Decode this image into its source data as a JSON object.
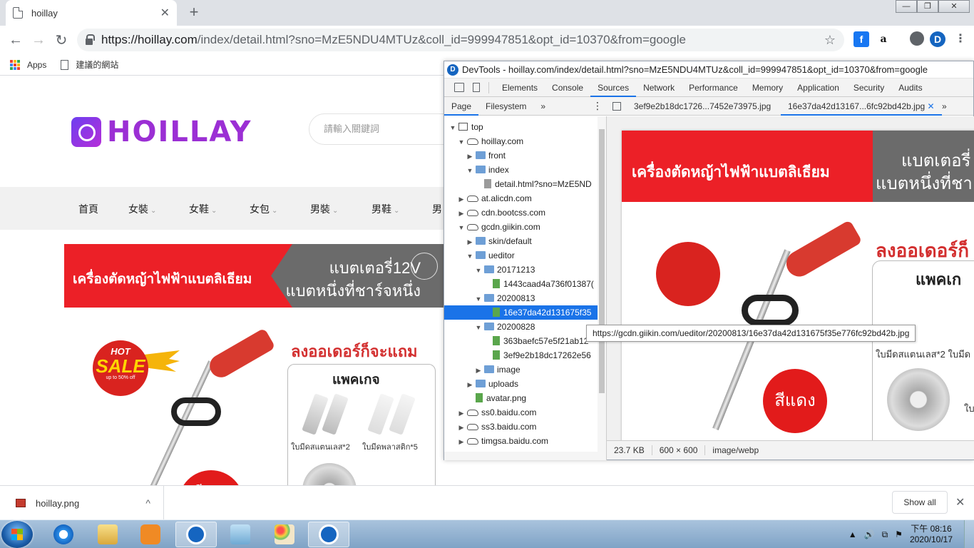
{
  "browser": {
    "tab_title": "hoillay",
    "tab_close": "✕",
    "new_tab": "+",
    "window_buttons": [
      "—",
      "❐",
      "✕"
    ],
    "url_host": "https://hoillay.com",
    "url_path": "/index/detail.html?sno=MzE5NDU4MTUz&coll_id=999947851&opt_id=10370&from=google",
    "nav": {
      "back": "←",
      "forward": "→",
      "reload": "↻"
    },
    "star": "☆",
    "extensions": {
      "facebook": "f",
      "amazon": "a",
      "downloader": "D",
      "menu": "⋮"
    },
    "bookmarks": [
      {
        "label": "Apps",
        "icon": "apps-grid-icon"
      },
      {
        "label": "建議的網站",
        "icon": "page-icon"
      }
    ]
  },
  "page": {
    "logo_text": "HOILLAY",
    "search_placeholder": "請輸入關鍵詞",
    "categories": [
      {
        "label": "首頁",
        "has_menu": false
      },
      {
        "label": "女裝",
        "has_menu": true
      },
      {
        "label": "女鞋",
        "has_menu": true
      },
      {
        "label": "女包",
        "has_menu": true
      },
      {
        "label": "男裝",
        "has_menu": true
      },
      {
        "label": "男鞋",
        "has_menu": true
      },
      {
        "label": "男",
        "has_menu": false
      }
    ],
    "category_chevron": "⌄",
    "banner": {
      "title": "เครื่องตัดหญ้าไฟฟ้าแบตลิเธียม",
      "sub1": "แบตเตอรี่12V",
      "sub2": "แบตหนึ่งที่ชาร์จหนึ่ง"
    },
    "product": {
      "sale_hot": "HOT",
      "sale_big": "SALE",
      "sale_small": "up to 50% off",
      "order_title": "ลงออเดอร์ก็จะแถม",
      "package_title": "แพคเกจ",
      "caption1": "ใบมีดสแตนเลส*2",
      "caption2": "ใบมีดพลาสติก*5",
      "color_label": "สีแดง"
    }
  },
  "devtools": {
    "title": "DevTools - hoillay.com/index/detail.html?sno=MzE5NDU4MTUz&coll_id=999947851&opt_id=10370&from=google",
    "logo": "D",
    "tabs": [
      "Elements",
      "Console",
      "Sources",
      "Network",
      "Performance",
      "Memory",
      "Application",
      "Security",
      "Audits"
    ],
    "active_tab": "Sources",
    "nav_tabs": [
      "Page",
      "Filesystem"
    ],
    "more": "»",
    "kebab": "⋮",
    "open_files": [
      {
        "name": "3ef9e2b18dc1726...7452e73975.jpg",
        "active": false
      },
      {
        "name": "16e37da42d13167...6fc92bd42b.jpg",
        "active": true
      }
    ],
    "close_tab": "✕",
    "tree": [
      {
        "depth": 0,
        "arrow": "▼",
        "icon": "frame",
        "label": "top"
      },
      {
        "depth": 1,
        "arrow": "▼",
        "icon": "cloud",
        "label": "hoillay.com"
      },
      {
        "depth": 2,
        "arrow": "▶",
        "icon": "folder",
        "label": "front"
      },
      {
        "depth": 2,
        "arrow": "▼",
        "icon": "folder",
        "label": "index"
      },
      {
        "depth": 3,
        "arrow": "",
        "icon": "file",
        "label": "detail.html?sno=MzE5ND"
      },
      {
        "depth": 1,
        "arrow": "▶",
        "icon": "cloud",
        "label": "at.alicdn.com"
      },
      {
        "depth": 1,
        "arrow": "▶",
        "icon": "cloud",
        "label": "cdn.bootcss.com"
      },
      {
        "depth": 1,
        "arrow": "▼",
        "icon": "cloud",
        "label": "gcdn.giikin.com"
      },
      {
        "depth": 2,
        "arrow": "▶",
        "icon": "folder",
        "label": "skin/default"
      },
      {
        "depth": 2,
        "arrow": "▼",
        "icon": "folder",
        "label": "ueditor"
      },
      {
        "depth": 3,
        "arrow": "▼",
        "icon": "folder",
        "label": "20171213"
      },
      {
        "depth": 4,
        "arrow": "",
        "icon": "image",
        "label": "1443caad4a736f01387("
      },
      {
        "depth": 3,
        "arrow": "▼",
        "icon": "folder",
        "label": "20200813"
      },
      {
        "depth": 4,
        "arrow": "",
        "icon": "image",
        "label": "16e37da42d131675f35",
        "selected": true
      },
      {
        "depth": 3,
        "arrow": "▼",
        "icon": "folder",
        "label": "20200828"
      },
      {
        "depth": 4,
        "arrow": "",
        "icon": "image",
        "label": "363baefc57e5f21ab12"
      },
      {
        "depth": 4,
        "arrow": "",
        "icon": "image",
        "label": "3ef9e2b18dc17262e56"
      },
      {
        "depth": 3,
        "arrow": "▶",
        "icon": "folder",
        "label": "image"
      },
      {
        "depth": 2,
        "arrow": "▶",
        "icon": "folder",
        "label": "uploads"
      },
      {
        "depth": 2,
        "arrow": "",
        "icon": "image",
        "label": "avatar.png"
      },
      {
        "depth": 1,
        "arrow": "▶",
        "icon": "cloud",
        "label": "ss0.baidu.com"
      },
      {
        "depth": 1,
        "arrow": "▶",
        "icon": "cloud",
        "label": "ss3.baidu.com"
      },
      {
        "depth": 1,
        "arrow": "▶",
        "icon": "cloud",
        "label": "timgsa.baidu.com"
      }
    ],
    "tooltip": "https://gcdn.giikin.com/ueditor/20200813/16e37da42d131675f35e776fc92bd42b.jpg",
    "status": {
      "size": "23.7 KB",
      "dimensions": "600 × 600",
      "mime": "image/webp"
    },
    "preview": {
      "banner_title": "เครื่องตัดหญ้าไฟฟ้าแบตลิเธียม",
      "banner_sub1": "แบตเตอรี่",
      "banner_sub2": "แบตหนึ่งที่ชา",
      "order_title": "ลงออเดอร์ก็",
      "package_title": "แพคเก",
      "caption": "ใบมีดสแตนเลส*2 ใบมีด",
      "color_label": "สีแดง",
      "side_text": "ใบ"
    }
  },
  "downloads": {
    "file": "hoillay.png",
    "chevron": "^",
    "show_all": "Show all",
    "close": "✕"
  },
  "taskbar": {
    "time": "下午 08:16",
    "date": "2020/10/17",
    "tray_symbols": [
      "▲",
      "🔊",
      "⧉",
      "⚑"
    ]
  },
  "colors": {
    "brand_purple": "#9b2fd4",
    "banner_red": "#ec2027",
    "devtools_active": "#1a73e8",
    "selection_blue": "#1a73e8"
  }
}
